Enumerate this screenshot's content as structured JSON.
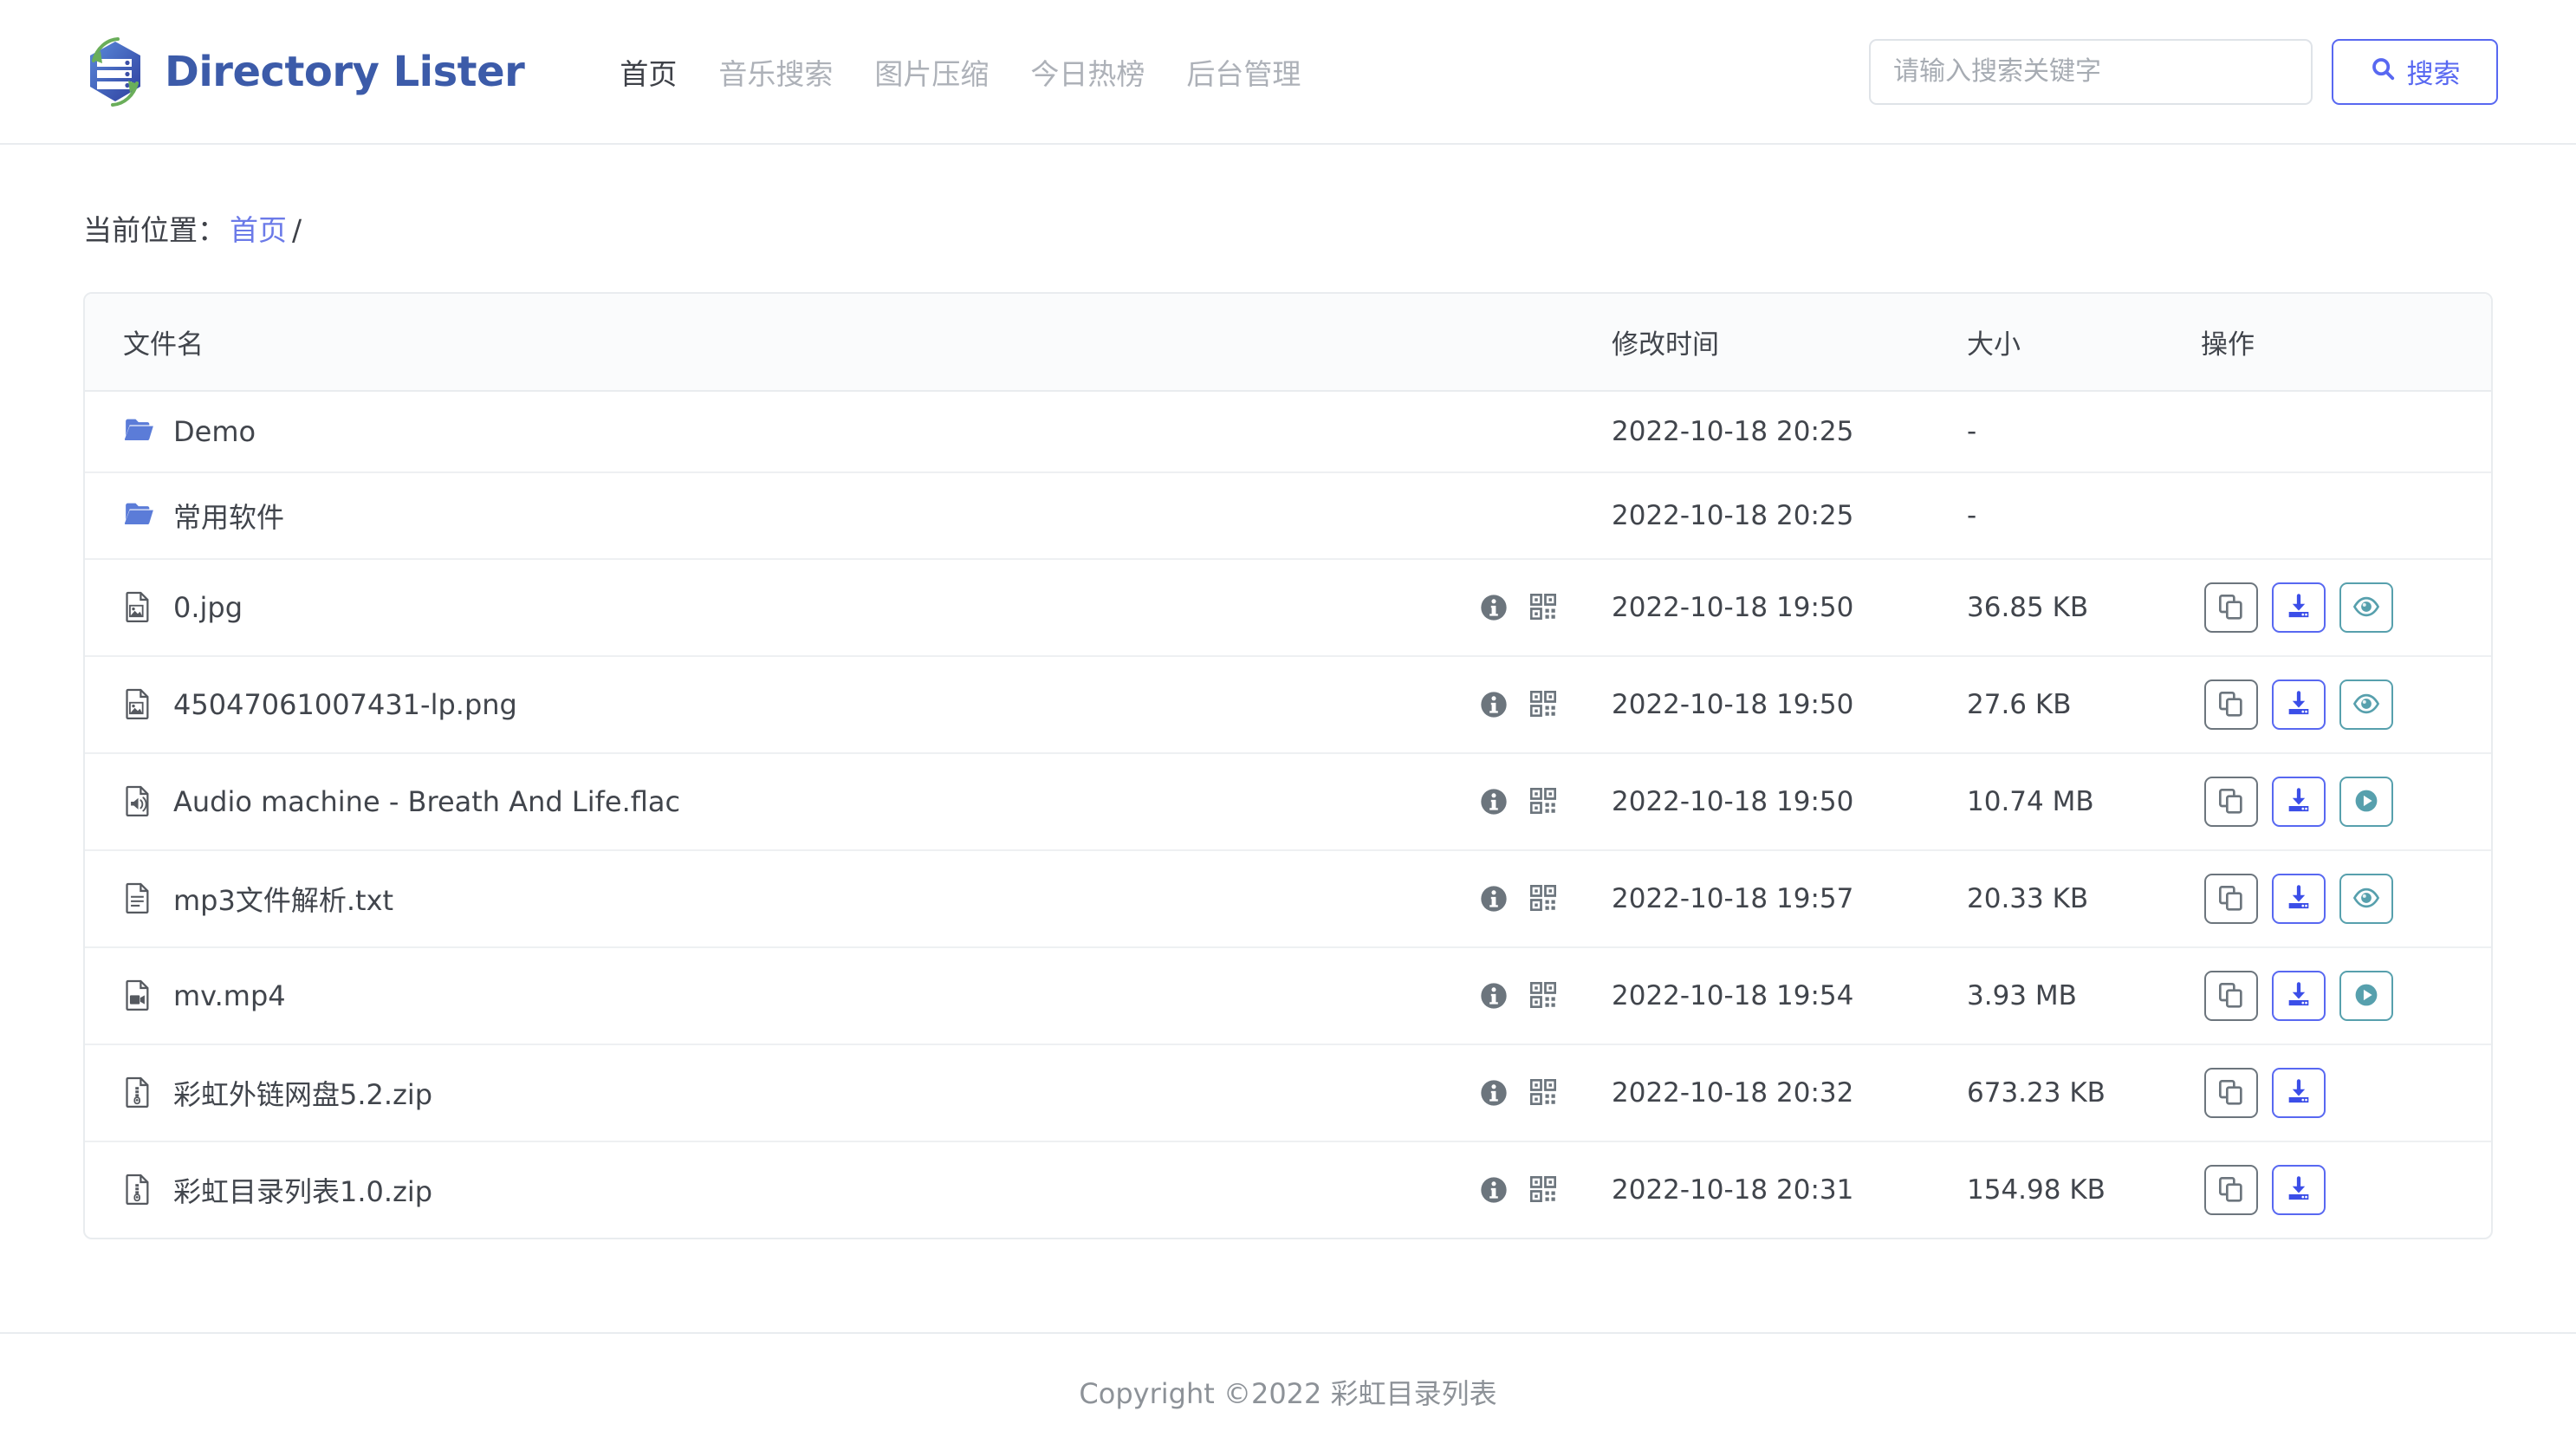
{
  "brand": {
    "title": "Directory Lister",
    "logo_icon": "directory-lister-logo-icon"
  },
  "nav": {
    "items": [
      {
        "label": "首页",
        "active": true
      },
      {
        "label": "音乐搜索",
        "active": false
      },
      {
        "label": "图片压缩",
        "active": false
      },
      {
        "label": "今日热榜",
        "active": false
      },
      {
        "label": "后台管理",
        "active": false
      }
    ]
  },
  "search": {
    "placeholder": "请输入搜索关键字",
    "value": "",
    "button_label": "搜索",
    "button_icon": "search-icon"
  },
  "breadcrumb": {
    "label": "当前位置：",
    "home_link": "首页",
    "separator": "/"
  },
  "table": {
    "headers": {
      "name": "文件名",
      "time": "修改时间",
      "size": "大小",
      "actions": "操作"
    },
    "rows": [
      {
        "icon": "folder-icon",
        "name": "Demo",
        "type": "folder",
        "time": "2022-10-18 20:25",
        "size": "-",
        "badges": [],
        "actions": []
      },
      {
        "icon": "folder-icon",
        "name": "常用软件",
        "type": "folder",
        "time": "2022-10-18 20:25",
        "size": "-",
        "badges": [],
        "actions": []
      },
      {
        "icon": "image-file-icon",
        "name": "0.jpg",
        "type": "image",
        "time": "2022-10-18 19:50",
        "size": "36.85 KB",
        "badges": [
          "info-icon",
          "qrcode-icon"
        ],
        "actions": [
          "copy-icon",
          "download-icon",
          "eye-icon"
        ]
      },
      {
        "icon": "image-file-icon",
        "name": "45047061007431-lp.png",
        "type": "image",
        "time": "2022-10-18 19:50",
        "size": "27.6 KB",
        "badges": [
          "info-icon",
          "qrcode-icon"
        ],
        "actions": [
          "copy-icon",
          "download-icon",
          "eye-icon"
        ]
      },
      {
        "icon": "audio-file-icon",
        "name": "Audio machine - Breath And Life.flac",
        "type": "audio",
        "time": "2022-10-18 19:50",
        "size": "10.74 MB",
        "badges": [
          "info-icon",
          "qrcode-icon"
        ],
        "actions": [
          "copy-icon",
          "download-icon",
          "play-icon"
        ]
      },
      {
        "icon": "text-file-icon",
        "name": "mp3文件解析.txt",
        "type": "text",
        "time": "2022-10-18 19:57",
        "size": "20.33 KB",
        "badges": [
          "info-icon",
          "qrcode-icon"
        ],
        "actions": [
          "copy-icon",
          "download-icon",
          "eye-icon"
        ]
      },
      {
        "icon": "video-file-icon",
        "name": "mv.mp4",
        "type": "video",
        "time": "2022-10-18 19:54",
        "size": "3.93 MB",
        "badges": [
          "info-icon",
          "qrcode-icon"
        ],
        "actions": [
          "copy-icon",
          "download-icon",
          "play-icon"
        ]
      },
      {
        "icon": "archive-file-icon",
        "name": "彩虹外链网盘5.2.zip",
        "type": "archive",
        "time": "2022-10-18 20:32",
        "size": "673.23 KB",
        "badges": [
          "info-icon",
          "qrcode-icon"
        ],
        "actions": [
          "copy-icon",
          "download-icon"
        ]
      },
      {
        "icon": "archive-file-icon",
        "name": "彩虹目录列表1.0.zip",
        "type": "archive",
        "time": "2022-10-18 20:31",
        "size": "154.98 KB",
        "badges": [
          "info-icon",
          "qrcode-icon"
        ],
        "actions": [
          "copy-icon",
          "download-icon"
        ]
      }
    ]
  },
  "footer": {
    "text": "Copyright ©2022 彩虹目录列表"
  },
  "colors": {
    "brand": "#3c5ba9",
    "primary": "#5868f1",
    "link": "#6b7ae8",
    "info": "#57a0ad",
    "secondary": "#6c757d",
    "folder": "#5b7cd8",
    "muted": "#8d9298",
    "border": "#e9ecef"
  }
}
